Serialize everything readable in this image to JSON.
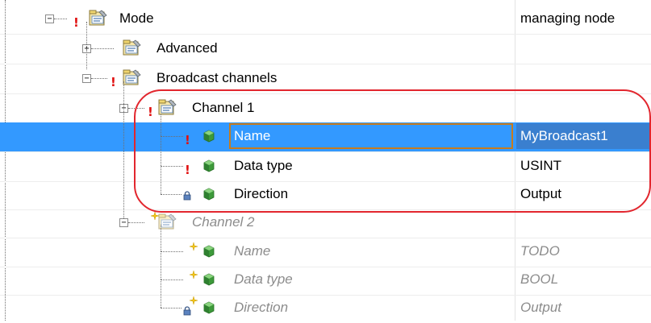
{
  "tree": {
    "mode": {
      "label": "Mode",
      "value": "managing node"
    },
    "advanced": {
      "label": "Advanced",
      "value": ""
    },
    "broadcast": {
      "label": "Broadcast channels",
      "value": ""
    },
    "channel1": {
      "label": "Channel 1",
      "params": [
        {
          "label": "Name",
          "value": "MyBroadcast1"
        },
        {
          "label": "Data type",
          "value": "USINT"
        },
        {
          "label": "Direction",
          "value": "Output"
        }
      ]
    },
    "channel2": {
      "label": "Channel 2",
      "params": [
        {
          "label": "Name",
          "value": "TODO"
        },
        {
          "label": "Data type",
          "value": "BOOL"
        },
        {
          "label": "Direction",
          "value": "Output"
        }
      ]
    }
  },
  "colors": {
    "selection": "#3399ff",
    "annotation": "#e2262e",
    "warning": "#e01010",
    "inactive_text": "#8c8c8c"
  },
  "icons": [
    "expand-icon",
    "collapse-icon",
    "folder-settings-icon",
    "parameter-icon",
    "lock-icon",
    "warning-icon",
    "new-item-icon"
  ]
}
